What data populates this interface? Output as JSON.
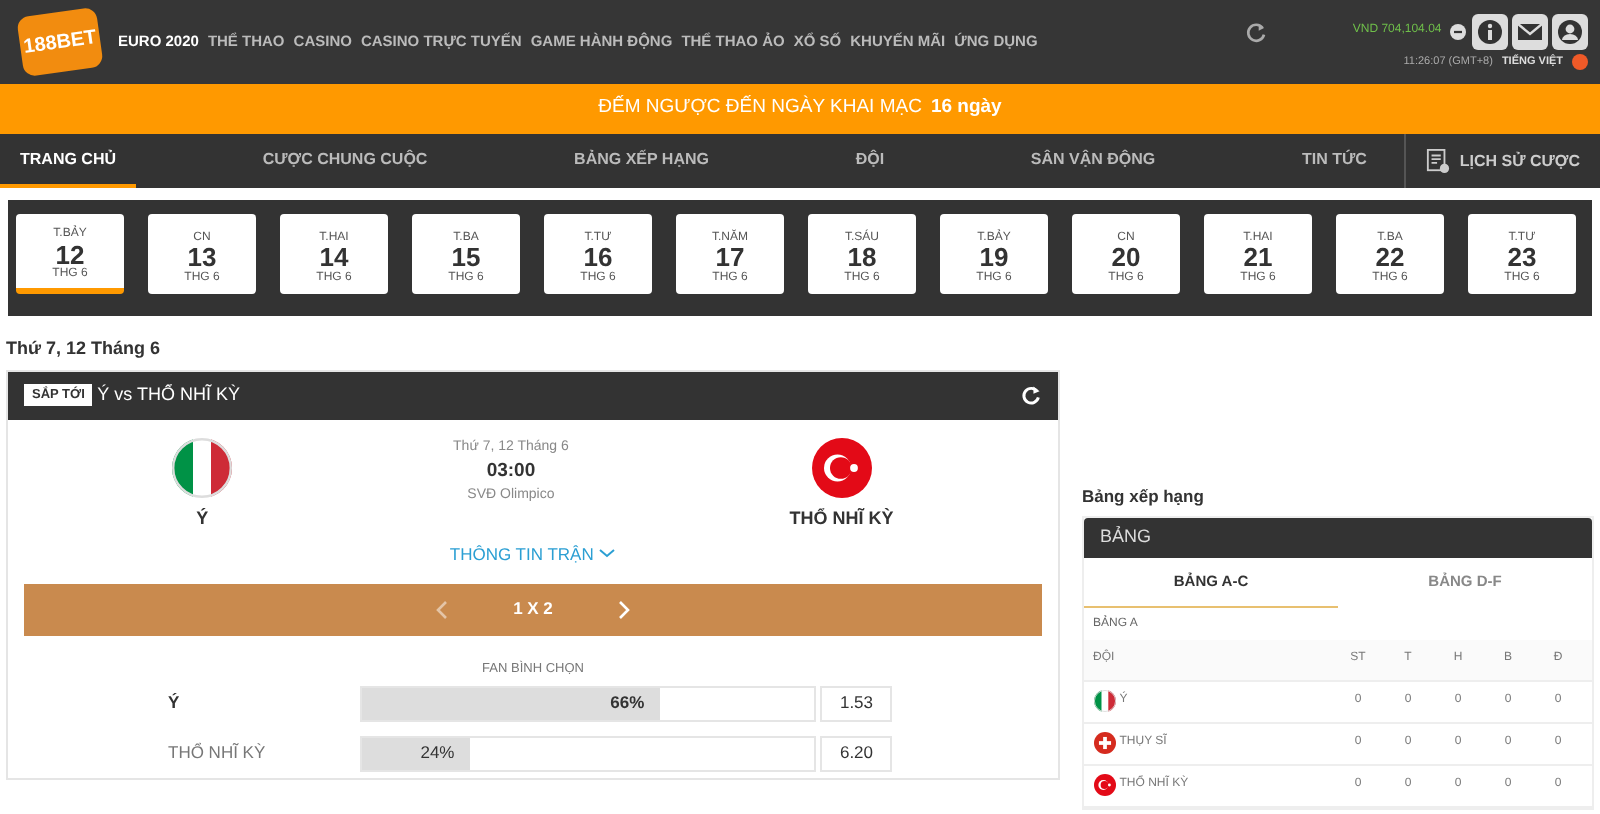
{
  "header": {
    "logo": "188BET",
    "nav": [
      {
        "label": "EURO 2020",
        "selected": true
      },
      {
        "label": "THỂ THAO",
        "selected": false
      },
      {
        "label": "CASINO",
        "selected": false
      },
      {
        "label": "CASINO TRỰC TUYẾN",
        "selected": false
      },
      {
        "label": "GAME HÀNH ĐỘNG",
        "selected": false
      },
      {
        "label": "THỂ THAO ẢO",
        "selected": false
      },
      {
        "label": "XỔ SỐ",
        "selected": false
      },
      {
        "label": "KHUYẾN MÃI",
        "selected": false
      },
      {
        "label": "ỨNG DỤNG",
        "selected": false
      }
    ],
    "balance": "VND 704,104.04",
    "clock": "11:26:07 (GMT+8)",
    "language": "TIẾNG VIỆT"
  },
  "banner": {
    "text": "ĐẾM NGƯỢC ĐẾN NGÀY KHAI MẠC",
    "count": "16 ngày"
  },
  "tabs": [
    {
      "label": "TRANG CHỦ",
      "selected": true
    },
    {
      "label": "CƯỢC CHUNG CUỘC",
      "selected": false
    },
    {
      "label": "BẢNG XẾP HẠNG",
      "selected": false
    },
    {
      "label": "ĐỘI",
      "selected": false
    },
    {
      "label": "SÂN VẬN ĐỘNG",
      "selected": false
    },
    {
      "label": "TIN TỨC",
      "selected": false
    }
  ],
  "history_button": "LỊCH SỬ CƯỢC",
  "dates": [
    {
      "weekday": "T.BẢY",
      "day": "12",
      "month": "THG 6",
      "selected": true
    },
    {
      "weekday": "CN",
      "day": "13",
      "month": "THG 6",
      "selected": false
    },
    {
      "weekday": "T.HAI",
      "day": "14",
      "month": "THG 6",
      "selected": false
    },
    {
      "weekday": "T.BA",
      "day": "15",
      "month": "THG 6",
      "selected": false
    },
    {
      "weekday": "T.TƯ",
      "day": "16",
      "month": "THG 6",
      "selected": false
    },
    {
      "weekday": "T.NĂM",
      "day": "17",
      "month": "THG 6",
      "selected": false
    },
    {
      "weekday": "T.SÁU",
      "day": "18",
      "month": "THG 6",
      "selected": false
    },
    {
      "weekday": "T.BẢY",
      "day": "19",
      "month": "THG 6",
      "selected": false
    },
    {
      "weekday": "CN",
      "day": "20",
      "month": "THG 6",
      "selected": false
    },
    {
      "weekday": "T.HAI",
      "day": "21",
      "month": "THG 6",
      "selected": false
    },
    {
      "weekday": "T.BA",
      "day": "22",
      "month": "THG 6",
      "selected": false
    },
    {
      "weekday": "T.TƯ",
      "day": "23",
      "month": "THG 6",
      "selected": false
    }
  ],
  "day_title": "Thứ 7, 12 Tháng 6",
  "match": {
    "badge": "SẮP TỚI",
    "title": "Ý vs THỔ NHĨ KỲ",
    "home": {
      "name": "Ý",
      "kind": "italy"
    },
    "away": {
      "name": "THỔ NHĨ KỲ",
      "kind": "turkey"
    },
    "date": "Thứ 7, 12 Tháng 6",
    "time": "03:00",
    "venue": "SVĐ Olimpico",
    "info_link": "THÔNG TIN TRẬN",
    "market": "1 X 2",
    "vote_title": "FAN BÌNH CHỌN",
    "votes": [
      {
        "team": "Ý",
        "percent": "66%",
        "level": 0.66,
        "odds": "1.53",
        "leading": true
      },
      {
        "team": "THỔ NHĨ KỲ",
        "percent": "24%",
        "level": 0.24,
        "odds": "6.20",
        "leading": false
      }
    ]
  },
  "standings": {
    "title": "Bảng xếp hạng",
    "header": "BẢNG",
    "tabs": [
      {
        "label": "BẢNG A-C",
        "selected": true
      },
      {
        "label": "BẢNG D-F",
        "selected": false
      }
    ],
    "group": "BẢNG A",
    "columns": [
      "ĐỘI",
      "ST",
      "T",
      "H",
      "B",
      "Đ"
    ],
    "rows": [
      {
        "kind": "italy",
        "cells": [
          "Ý",
          "0",
          "0",
          "0",
          "0",
          "0"
        ]
      },
      {
        "kind": "switzerland",
        "cells": [
          "THỤY SĨ",
          "0",
          "0",
          "0",
          "0",
          "0"
        ]
      },
      {
        "kind": "turkey",
        "cells": [
          "THỔ NHĨ KỲ",
          "0",
          "0",
          "0",
          "0",
          "0"
        ]
      }
    ]
  }
}
